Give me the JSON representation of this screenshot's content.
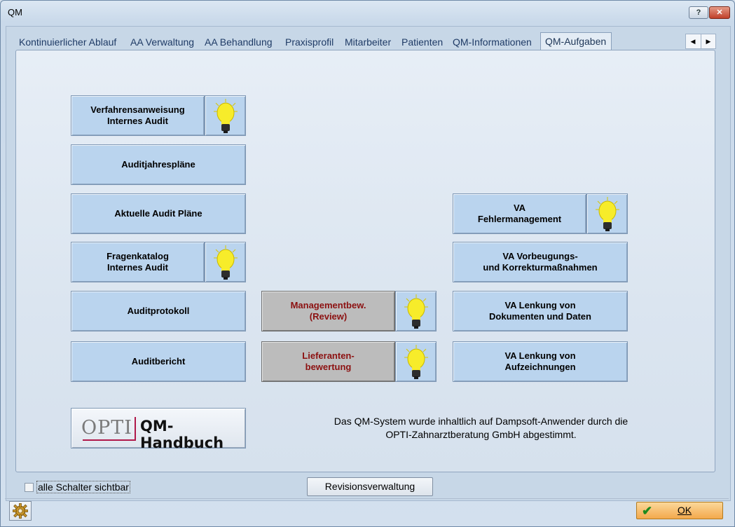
{
  "window": {
    "title": "QM",
    "help": "?",
    "close": "✕"
  },
  "tabs": [
    "Kontinuierlicher Ablauf",
    "AA Verwaltung",
    "AA  Behandlung",
    "Praxisprofil",
    "Mitarbeiter",
    "Patienten",
    "QM-Informationen",
    "QM-Aufgaben"
  ],
  "active_tab": "QM-Aufgaben",
  "tab_scroll": {
    "left": "◀",
    "right": "▶"
  },
  "left_column": {
    "va_internes_audit": "Verfahrensanweisung\nInternes Audit",
    "auditjahresplaene": "Auditjahrespläne",
    "aktuelle_audit_plaene": "Aktuelle Audit Pläne",
    "fragenkatalog": "Fragenkatalog\nInternes Audit",
    "auditprotokoll": "Auditprotokoll",
    "auditbericht": "Auditbericht"
  },
  "middle_column": {
    "managementbewertung": "Managementbew.\n(Review)",
    "lieferantenbewertung": "Lieferanten-\nbewertung"
  },
  "right_column": {
    "va_fehlermanagement": "VA\nFehlermanagement",
    "va_vorbeugung": "VA Vorbeugungs-\nund Korrekturmaßnahmen",
    "va_lenkung_dokumente": "VA Lenkung von\nDokumenten und Daten",
    "va_lenkung_aufzeichnungen": "VA Lenkung von\nAufzeichnungen"
  },
  "handbook": {
    "brand": "OPTI",
    "label": "QM-Handbuch"
  },
  "info_text": "Das QM-System wurde inhaltlich auf Dampsoft-Anwender durch die\nOPTI-Zahnarztberatung GmbH abgestimmt.",
  "footer": {
    "checkbox_label": "alle Schalter sichtbar",
    "checkbox_checked": false,
    "revision_button": "Revisionsverwaltung",
    "ok_button": "OK"
  },
  "colors": {
    "button_blue": "#bad4ee",
    "button_gray": "#bcbcbc",
    "gray_text": "#8c1111",
    "bulb": "#f7ec2a",
    "ok_orange": "#f3a94c"
  },
  "icons": [
    "lightbulb-icon",
    "gear-icon",
    "checkmark-icon",
    "help-icon",
    "close-icon"
  ]
}
